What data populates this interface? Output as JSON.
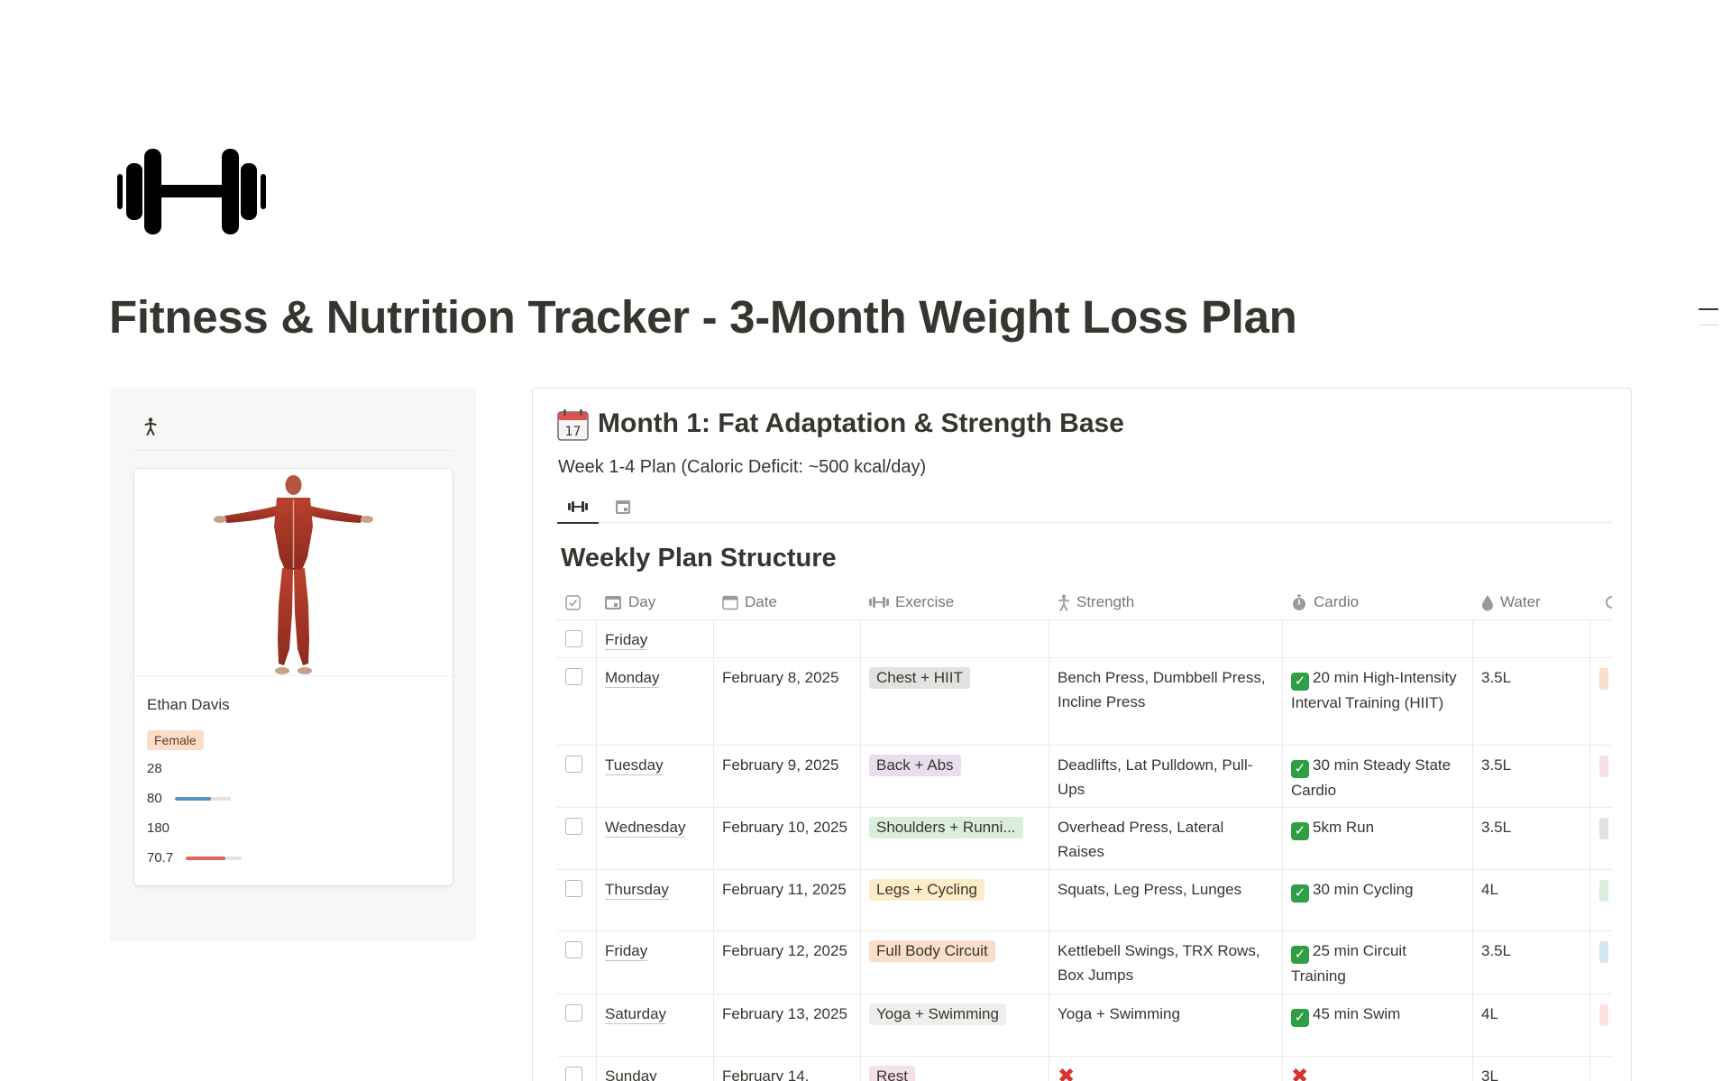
{
  "page": {
    "title": "Fitness & Nutrition Tracker - 3-Month Weight Loss Plan",
    "icon": "dumbbell-icon"
  },
  "profile": {
    "tab_icon": "person-walking-icon",
    "name": "Ethan Davis",
    "gender": "Female",
    "age": "28",
    "weight": "80",
    "weight_progress": 0.65,
    "height": "180",
    "target": "70.7",
    "target_progress": 0.7,
    "colors": {
      "weight_bar": "#5b8fbd",
      "target_bar": "#d96b5a"
    }
  },
  "month": {
    "icon": "calendar-icon",
    "title": "Month 1: Fat Adaptation & Strength Base",
    "subtitle": "Week 1-4 Plan (Caloric Deficit: ~500 kcal/day)",
    "tabs": [
      {
        "icon": "dumbbell-icon",
        "active": true
      },
      {
        "icon": "calendar-icon",
        "active": false
      }
    ],
    "section_title": "Weekly Plan Structure",
    "columns": [
      "Day",
      "Date",
      "Exercise",
      "Strength",
      "Cardio",
      "Water"
    ],
    "rows": [
      {
        "day": "Friday",
        "date": "",
        "exercise": "",
        "exercise_color": "",
        "strength": "",
        "cardio": "",
        "cardio_done": null,
        "water": "",
        "extra_color": ""
      },
      {
        "day": "Monday",
        "date": "February 8, 2025",
        "exercise": "Chest + HIIT",
        "exercise_color": "#e3e2e0",
        "strength": "Bench Press, Dumbbell Press, Incline Press",
        "cardio": "20 min High-Intensity Interval Training (HIIT)",
        "cardio_done": true,
        "water": "3.5L",
        "extra_color": "#fadec9"
      },
      {
        "day": "Tuesday",
        "date": "February 9, 2025",
        "exercise": "Back + Abs",
        "exercise_color": "#e8deee",
        "strength": "Deadlifts, Lat Pulldown, Pull-Ups",
        "cardio": "30 min Steady State Cardio",
        "cardio_done": true,
        "water": "3.5L",
        "extra_color": "#f5e0e9"
      },
      {
        "day": "Wednesday",
        "date": "February 10, 2025",
        "exercise": "Shoulders + Runni...",
        "exercise_color": "#dbeddb",
        "strength": "Overhead Press, Lateral Raises",
        "cardio": "5km Run",
        "cardio_done": true,
        "water": "3.5L",
        "extra_color": "#e3e2e0"
      },
      {
        "day": "Thursday",
        "date": "February 11, 2025",
        "exercise": "Legs + Cycling",
        "exercise_color": "#fdecc8",
        "strength": "Squats, Leg Press, Lunges",
        "cardio": "30 min Cycling",
        "cardio_done": true,
        "water": "4L",
        "extra_color": "#dbeddb"
      },
      {
        "day": "Friday",
        "date": "February 12, 2025",
        "exercise": "Full Body Circuit",
        "exercise_color": "#fadec9",
        "strength": "Kettlebell Swings, TRX Rows, Box Jumps",
        "cardio": "25 min Circuit Training",
        "cardio_done": true,
        "water": "3.5L",
        "extra_color": "#d3e5ef"
      },
      {
        "day": "Saturday",
        "date": "February 13, 2025",
        "exercise": "Yoga + Swimming",
        "exercise_color": "#eeeeec",
        "strength": "Yoga + Swimming",
        "cardio": "45 min Swim",
        "cardio_done": true,
        "water": "4L",
        "extra_color": "#ffe2dd"
      },
      {
        "day": "Sunday",
        "date": "February 14,",
        "exercise": "Rest",
        "exercise_color": "#f5e0e9",
        "strength": "",
        "strength_cross": true,
        "cardio": "",
        "cardio_done": false,
        "water": "3L",
        "extra_color": ""
      }
    ]
  }
}
